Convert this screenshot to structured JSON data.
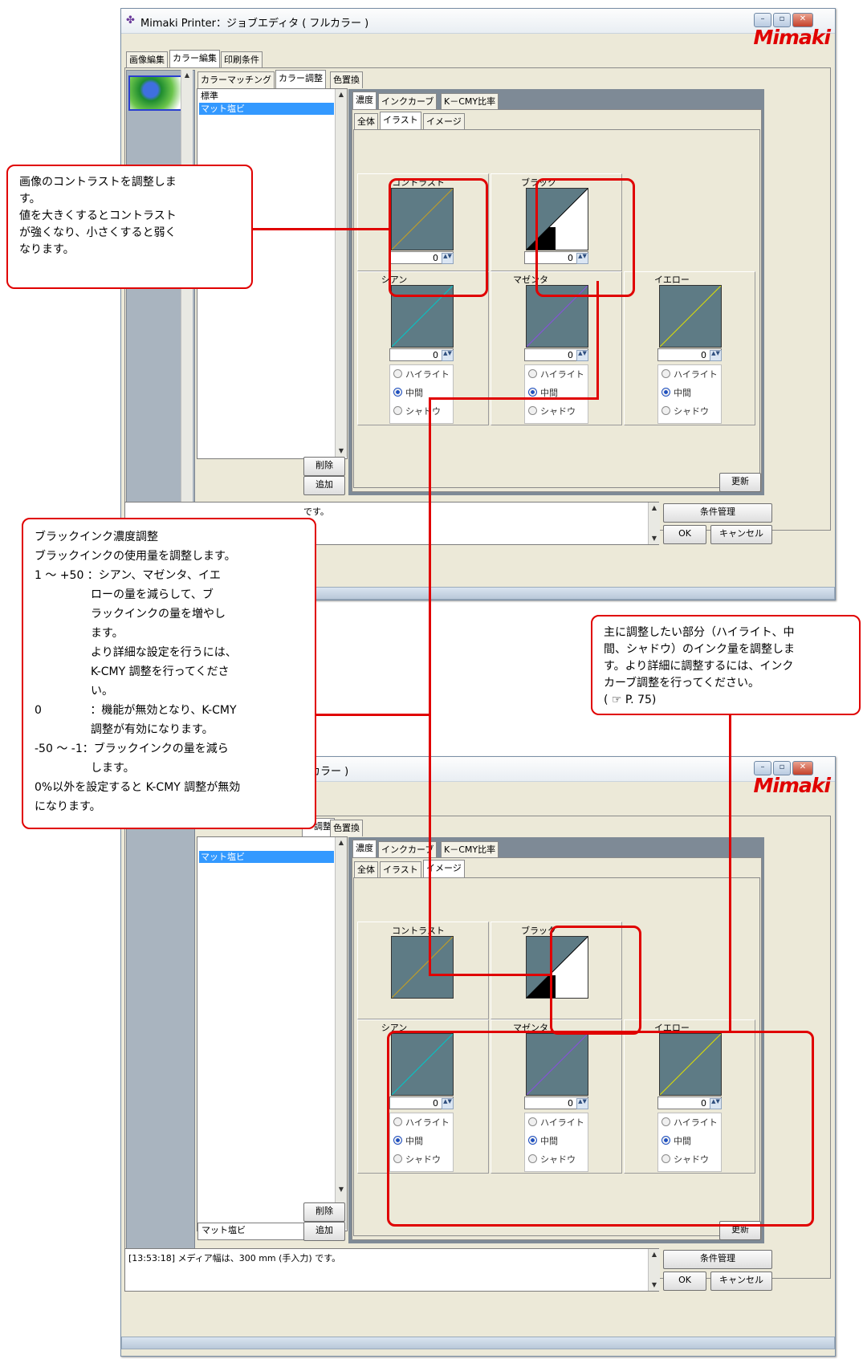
{
  "window": {
    "title": "Mimaki Printer：ジョブエディタ ( フルカラー )",
    "title_partial": "カラー )",
    "logo": "Mimaki",
    "minimize": "–",
    "maximize": "▫",
    "close": "✕"
  },
  "main_tabs": [
    "画像編集",
    "カラー編集",
    "印刷条件"
  ],
  "color_tabs": [
    "カラーマッチング",
    "カラー調整",
    "色置換"
  ],
  "color_tab_partial": "ー調整",
  "adjust_tabs": [
    "濃度",
    "インクカーブ",
    "K－CMY比率"
  ],
  "sub_tabs": [
    "全体",
    "イラスト",
    "イメージ"
  ],
  "list_items": [
    "標準",
    "マット塩ビ"
  ],
  "buttons": {
    "delete": "削除",
    "add": "追加",
    "update": "更新",
    "condition": "条件管理",
    "ok": "OK",
    "cancel": "キャンセル"
  },
  "profile_name": "マット塩ビ",
  "controls": {
    "contrast": {
      "label": "コントラスト",
      "value": "0"
    },
    "black": {
      "label": "ブラック",
      "value": "0"
    },
    "cyan": {
      "label": "シアン",
      "value": "0"
    },
    "magenta": {
      "label": "マゼンタ",
      "value": "0"
    },
    "yellow": {
      "label": "イエロー",
      "value": "0"
    }
  },
  "radio_options": [
    "ハイライト",
    "中間",
    "シャドウ"
  ],
  "radio_selected": "中間",
  "message": "[13:53:18] メディア幅は、300 mm (手入力) です。",
  "message_partial": "です。",
  "callouts": {
    "contrast": [
      "画像のコントラストを調整しま",
      "す。",
      "値を大きくするとコントラスト",
      "が強くなり、小さくすると弱く",
      "なります。"
    ],
    "black": [
      "ブラックインク濃度調整",
      "ブラックインクの使用量を調整します。",
      "1 ～ +50 ：シアン、マゼンタ、イエ",
      "　　　　　ローの量を減らして、ブ",
      "　　　　　ラックインクの量を増やし",
      "　　　　　ます。",
      "　　　　　より詳細な設定を行うには、",
      "　　　　　K-CMY 調整を行ってくださ",
      "　　　　　い。",
      "0 　　　　：機能が無効となり、K-CMY",
      "　　　　　調整が有効になります。",
      "-50 ～ -1：ブラックインクの量を減ら",
      "　　　　　します。",
      "0%以外を設定すると K-CMY 調整が無効",
      "になります。"
    ],
    "cmy": [
      "主に調整したい部分（ハイライト、中",
      "間、シャドウ）のインク量を調整しま",
      "す。より詳細に調整するには、インク",
      "カーブ調整を行ってください。",
      "( ☞ P. 75)"
    ]
  }
}
